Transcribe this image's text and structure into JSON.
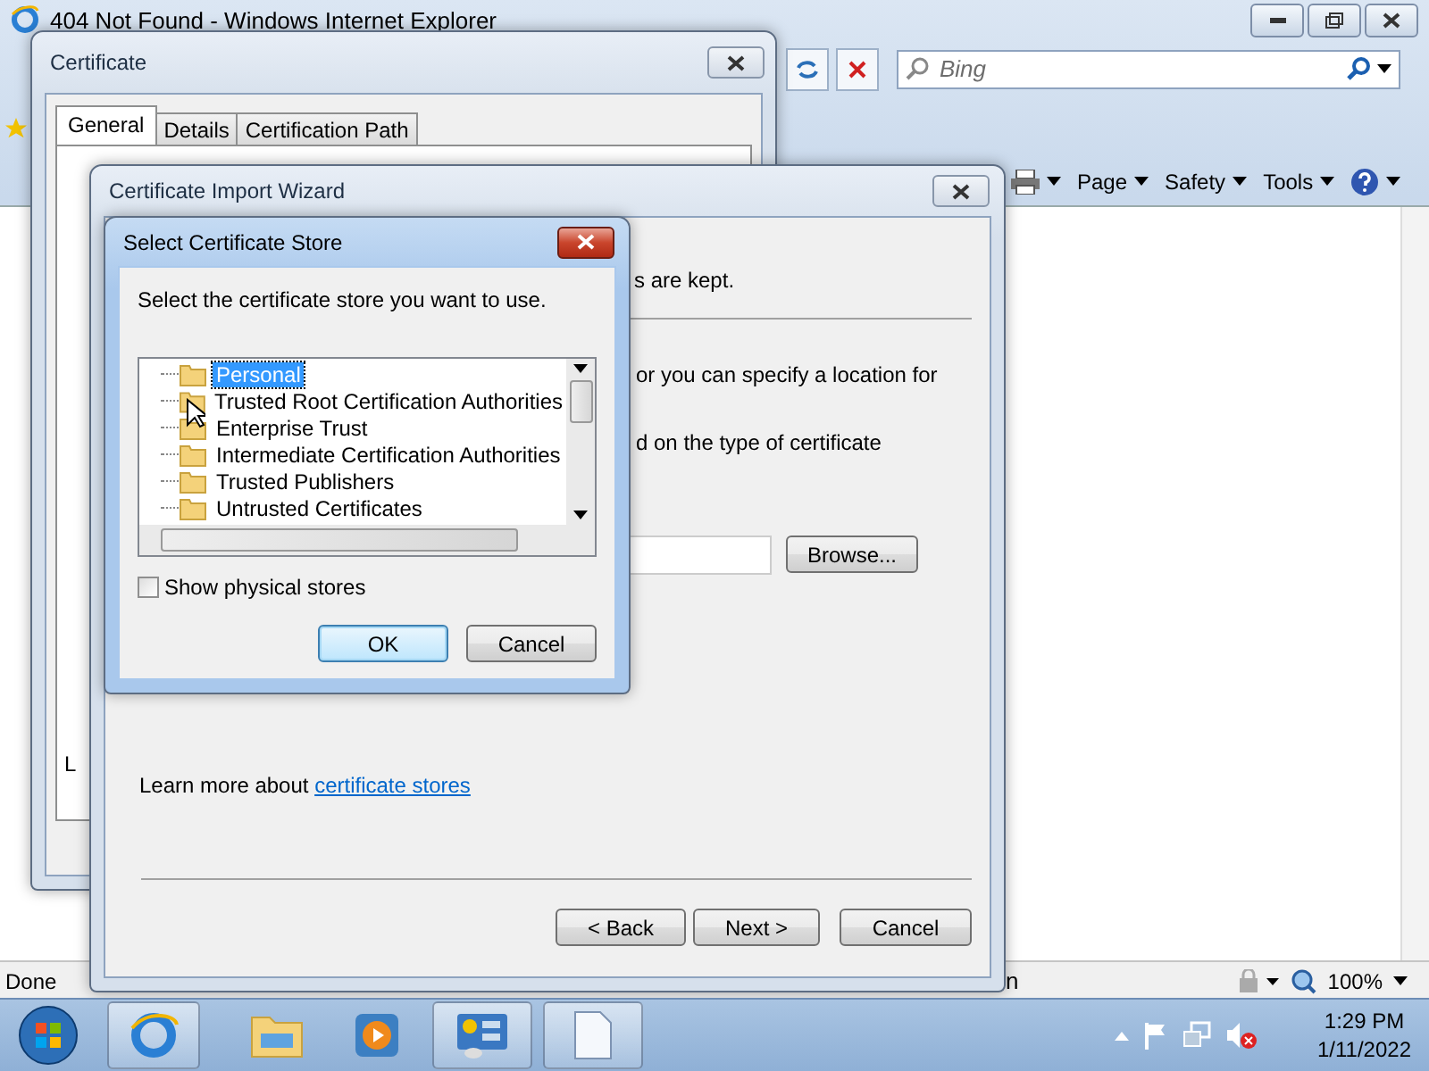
{
  "browser": {
    "title": "404 Not Found - Windows Internet Explorer",
    "search": {
      "placeholder": "Bing"
    },
    "command_bar": [
      "Page",
      "Safety",
      "Tools"
    ],
    "status_bar": {
      "text": "Done",
      "fragment": "n",
      "zoom": "100%"
    }
  },
  "certificate": {
    "title": "Certificate",
    "tabs": [
      {
        "label": "General",
        "selected": true
      },
      {
        "label": "Details",
        "selected": false
      },
      {
        "label": "Certification Path",
        "selected": false
      }
    ],
    "fragment": "L"
  },
  "wizard": {
    "title": "Certificate Import Wizard",
    "fragments": [
      "s are kept.",
      "or you can specify a location for",
      "d on the type of certificate"
    ],
    "browse": "Browse...",
    "learn_more": {
      "text": "Learn more about ",
      "link": "certificate stores"
    },
    "buttons": [
      "< Back",
      "Next >",
      "Cancel"
    ]
  },
  "store_dialog": {
    "title": "Select Certificate Store",
    "prompt": "Select the certificate store you want to use.",
    "stores": [
      {
        "label": "Personal",
        "selected": true
      },
      {
        "label": "Trusted Root Certification Authorities",
        "selected": false
      },
      {
        "label": "Enterprise Trust",
        "selected": false
      },
      {
        "label": "Intermediate Certification Authorities",
        "selected": false
      },
      {
        "label": "Trusted Publishers",
        "selected": false
      },
      {
        "label": "Untrusted Certificates",
        "selected": false
      }
    ],
    "show_physical_stores": {
      "label": "Show physical stores",
      "checked": false
    },
    "buttons": [
      "OK",
      "Cancel"
    ]
  },
  "taskbar": {
    "time": "1:29 PM",
    "date": "1/11/2022"
  }
}
